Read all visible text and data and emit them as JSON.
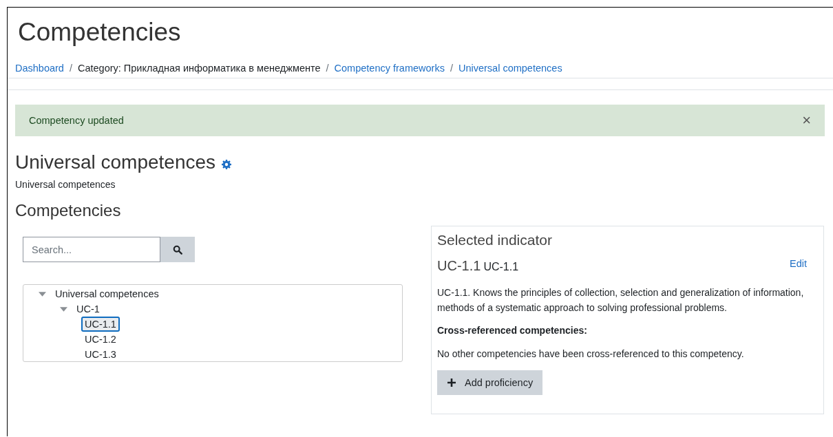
{
  "page_title": "Competencies",
  "breadcrumb_separator": "/",
  "breadcrumb": [
    {
      "label": "Dashboard",
      "link": true
    },
    {
      "label": "Category: Прикладная информатика в менеджменте",
      "link": false
    },
    {
      "label": "Competency frameworks",
      "link": true
    },
    {
      "label": "Universal competences",
      "link": true
    }
  ],
  "alert": {
    "message": "Competency updated",
    "close": "×"
  },
  "framework": {
    "title": "Universal competences",
    "description": "Universal competences"
  },
  "section_title": "Competencies",
  "search": {
    "placeholder": "Search..."
  },
  "tree": [
    {
      "label": "Universal competences",
      "expanded": true,
      "selected": false,
      "children": [
        {
          "label": "UC-1",
          "expanded": true,
          "selected": false,
          "children": [
            {
              "label": "UC-1.1",
              "selected": true
            },
            {
              "label": "UC-1.2",
              "selected": false
            },
            {
              "label": "UC-1.3",
              "selected": false
            }
          ]
        }
      ]
    }
  ],
  "panel": {
    "title": "Selected indicator",
    "idnumber": "UC-1.1",
    "shortname": "UC-1.1",
    "edit": "Edit",
    "description": "UC-1.1. Knows the principles of collection, selection and generalization of information, methods of a systematic approach to solving professional problems.",
    "cross_title": "Cross-referenced competencies:",
    "cross_text": "No other competencies have been cross-referenced to this competency.",
    "add_button": "Add proficiency"
  }
}
